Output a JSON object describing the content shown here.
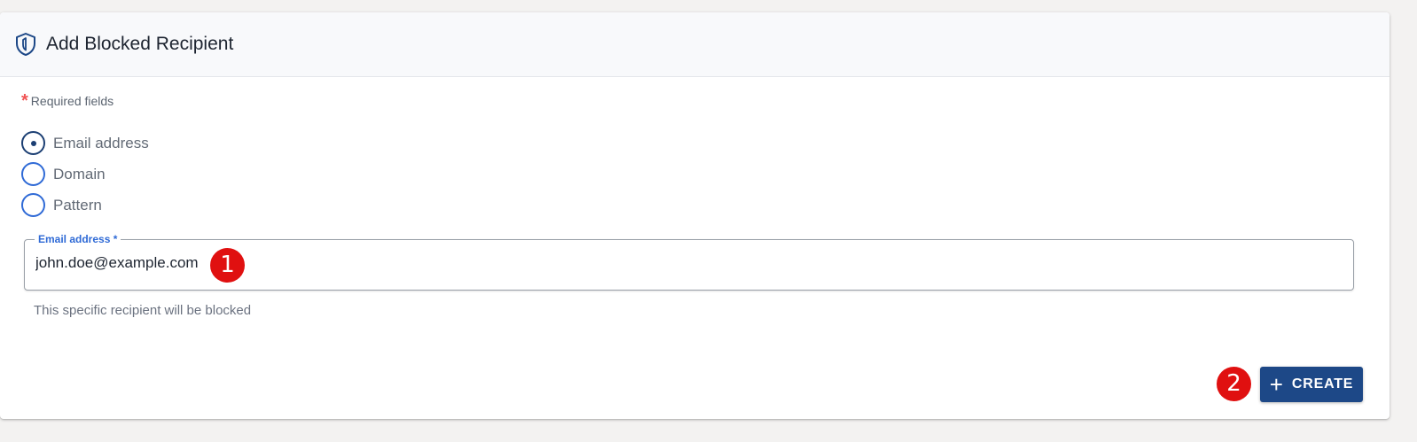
{
  "header": {
    "title": "Add Blocked Recipient",
    "icon": "shield-icon"
  },
  "form": {
    "required_marker": "*",
    "required_text": "Required fields",
    "options": [
      {
        "label": "Email address",
        "checked": true
      },
      {
        "label": "Domain",
        "checked": false
      },
      {
        "label": "Pattern",
        "checked": false
      }
    ],
    "field": {
      "label": "Email address *",
      "value": "john.doe@example.com"
    },
    "hint": "This specific recipient will be blocked"
  },
  "actions": {
    "create_label": "CREATE",
    "create_icon": "plus-icon"
  },
  "markers": {
    "one": "1",
    "two": "2"
  },
  "colors": {
    "primary": "#1d4887",
    "radio_border": "#2f6ad6",
    "marker": "#e01010",
    "required": "#f05454"
  }
}
